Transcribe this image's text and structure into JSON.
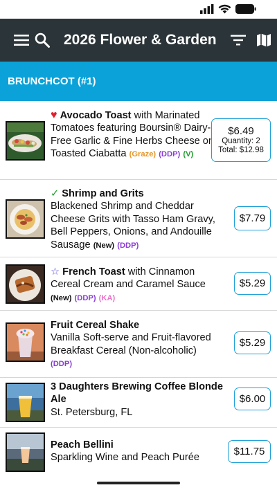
{
  "app": {
    "title": "2026 Flower & Garden",
    "icons": [
      "menu-icon",
      "search-icon",
      "filter-icon",
      "map-icon"
    ]
  },
  "section": {
    "title": "BRUNCHCOT (#1)"
  },
  "items": [
    {
      "marker": "♥",
      "name": "Avocado Toast",
      "description": " with Marinated Tomatoes featuring Boursin® Dairy-Free Garlic & Fine Herbs Cheese on Toasted Ciabatta",
      "tags": [
        "(Graze)",
        "(DDP)",
        "(V)"
      ],
      "price": "$6.49",
      "quantity": "Quantity: 2",
      "total": "Total: $12.98"
    },
    {
      "marker": "✓",
      "name": "Shrimp and Grits",
      "description": "Blackened Shrimp and Cheddar Cheese Grits with Tasso Ham Gravy, Bell Peppers, Onions, and Andouille Sausage",
      "tags": [
        "(New)",
        "(DDP)"
      ],
      "price": "$7.79"
    },
    {
      "marker": "☆",
      "name": "French Toast",
      "description": " with Cinnamon Cereal Cream and Caramel Sauce",
      "tags": [
        "(New)",
        "(DDP)",
        "(KA)"
      ],
      "price": "$5.29"
    },
    {
      "name": "Fruit Cereal Shake",
      "description": "Vanilla Soft-serve and Fruit-flavored Breakfast Cereal (Non-alcoholic)",
      "tags": [
        "(DDP)"
      ],
      "price": "$5.29"
    },
    {
      "name": "3 Daughters Brewing Coffee Blonde Ale",
      "description": "St. Petersburg, FL",
      "price": "$6.00"
    },
    {
      "name": "Peach Bellini",
      "description": "Sparkling Wine and Peach Purée",
      "price": "$11.75"
    }
  ],
  "colors": {
    "app_bar": "#2b3438",
    "section_header": "#0aa2d8",
    "price_border": "#1ea0d6",
    "heart": "#e0202c",
    "check": "#1e9e2e",
    "graze": "#e4962a",
    "ddp": "#8a3bd6",
    "ka": "#e872c8"
  }
}
